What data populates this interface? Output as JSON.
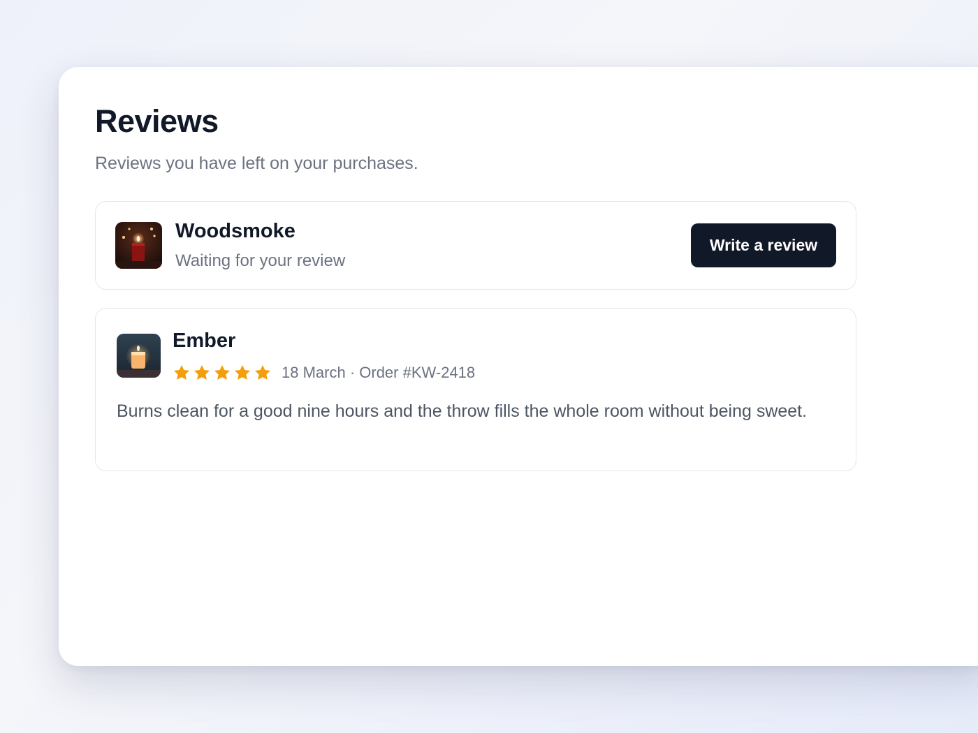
{
  "page": {
    "title": "Reviews",
    "subtitle": "Reviews you have left on your purchases."
  },
  "pending_review": {
    "product_name": "Woodsmoke",
    "status": "Waiting for your review",
    "action_label": "Write a review",
    "thumbnail_icon": "candle-photo-dark"
  },
  "completed_review": {
    "product_name": "Ember",
    "rating": 5,
    "rating_max": 5,
    "meta": "18 March · Order #KW-2418",
    "body": "Burns clean for a good nine hours and the throw fills the whole room without being sweet.",
    "thumbnail_icon": "candle-photo-glowing"
  },
  "colors": {
    "accent": "#111827",
    "star": "#f59e0b",
    "muted_text": "#6b7280",
    "border": "#e5e7eb"
  }
}
